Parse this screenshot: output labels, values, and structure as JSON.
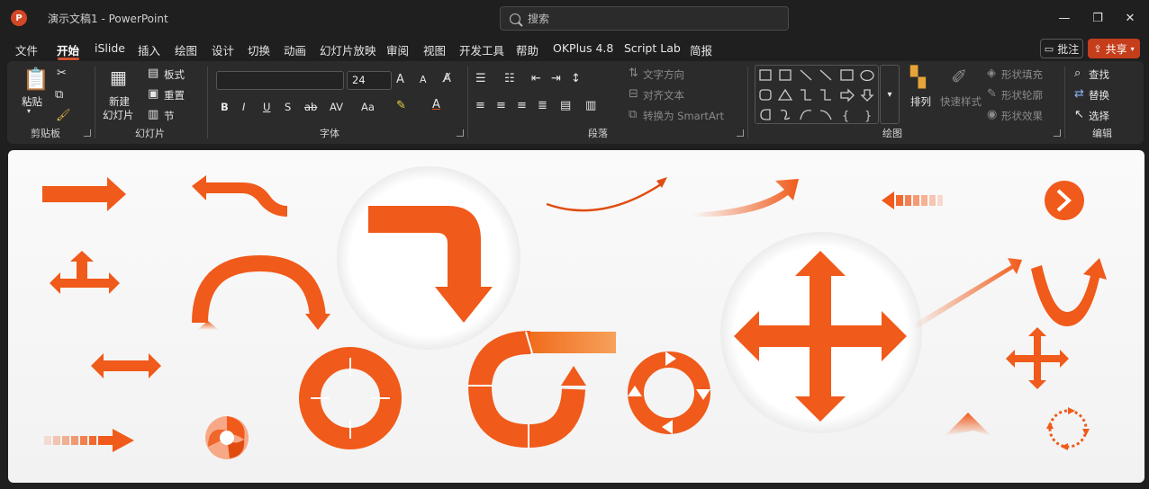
{
  "titlebar": {
    "app_logo": "P",
    "doc_title": "演示文稿1  -  PowerPoint",
    "search_placeholder": "搜索",
    "minimize": "—",
    "restore": "❐",
    "close": "✕"
  },
  "menu": {
    "tabs": [
      "文件",
      "开始",
      "iSlide",
      "插入",
      "绘图",
      "设计",
      "切换",
      "动画",
      "幻灯片放映",
      "审阅",
      "视图",
      "开发工具",
      "帮助",
      "OKPlus 4.8",
      "Script Lab",
      "简报"
    ],
    "active_tab": "开始",
    "comment_label": "批注",
    "share_label": "共享"
  },
  "ribbon": {
    "clipboard": {
      "group": "剪贴板",
      "paste": "粘贴"
    },
    "slides": {
      "group": "幻灯片",
      "new_slide_1": "新建",
      "new_slide_2": "幻灯片",
      "layout": "板式",
      "reset": "重置",
      "section": "节"
    },
    "font": {
      "group": "字体",
      "font_name": "",
      "font_size": "24",
      "bold": "B",
      "italic": "I",
      "underline": "U",
      "shadow": "S",
      "strike": "ab",
      "spacing": "AV",
      "case": "Aa",
      "grow": "A",
      "shrink": "A"
    },
    "paragraph": {
      "group": "段落",
      "text_direction": "文字方向",
      "align_text": "对齐文本",
      "convert_smartart": "转换为 SmartArt"
    },
    "drawing": {
      "group": "绘图",
      "arrange": "排列",
      "quick_styles": "快速样式",
      "shape_fill": "形状填充",
      "shape_outline": "形状轮廓",
      "shape_effects": "形状效果"
    },
    "editing": {
      "group": "编辑",
      "find": "查找",
      "replace": "替换",
      "select": "选择"
    }
  },
  "colors": {
    "accent": "#f05a1a",
    "accent_dark": "#e04c10",
    "accent_light": "#f7a15a",
    "share": "#c43e1c"
  },
  "slide": {
    "content": "arrow shape collection (orange)"
  }
}
